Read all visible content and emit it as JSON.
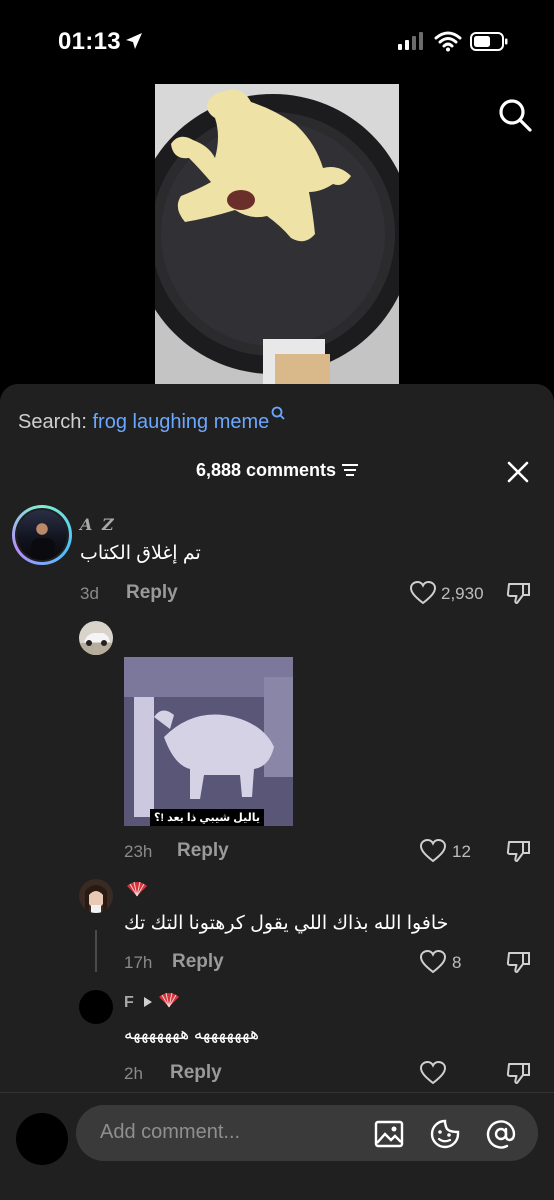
{
  "status": {
    "time": "01:13"
  },
  "search": {
    "label": "Search:",
    "term": "frog laughing meme"
  },
  "header": {
    "count_label": "6,888 comments"
  },
  "comments": [
    {
      "user": "A Z",
      "text": "تم إغلاق الكتاب",
      "time": "3d",
      "reply": "Reply",
      "likes": "2,930"
    },
    {
      "user": "",
      "caption": "ياليل شيبي ذا بعد !؟",
      "time": "23h",
      "reply": "Reply",
      "likes": "12"
    },
    {
      "user": "",
      "text": "خافوا الله بذاك اللي يقول كرهتونا التك تك",
      "time": "17h",
      "reply": "Reply",
      "likes": "8"
    },
    {
      "user": "F",
      "text": "هههههههه هههههههه",
      "time": "2h",
      "reply": "Reply",
      "likes": ""
    }
  ],
  "input": {
    "placeholder": "Add comment..."
  },
  "colors": {
    "search_term": "#6aa7ff",
    "sheet_bg": "#202020",
    "input_bg": "#3a3a3a"
  }
}
